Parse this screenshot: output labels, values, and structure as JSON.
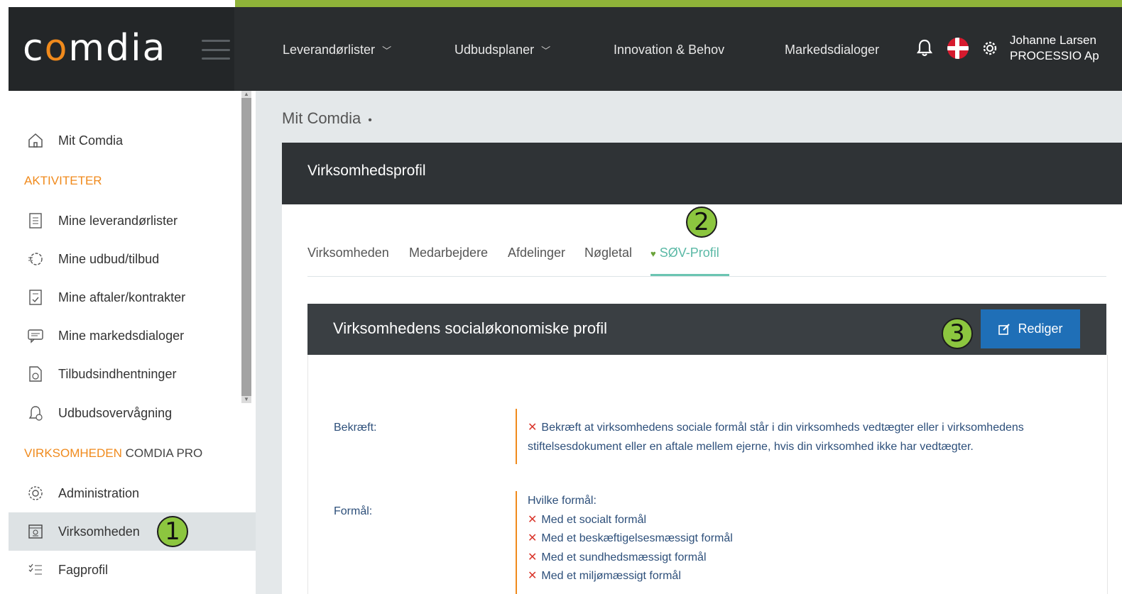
{
  "app": {
    "logo_prefix": "c",
    "logo_o": "o",
    "logo_suffix": "mdia"
  },
  "topnav": {
    "items": [
      {
        "label": "Leverandørlister",
        "has_dropdown": true
      },
      {
        "label": "Udbudsplaner",
        "has_dropdown": true
      },
      {
        "label": "Innovation & Behov",
        "has_dropdown": false
      },
      {
        "label": "Markedsdialoger",
        "has_dropdown": false
      }
    ],
    "user_name": "Johanne Larsen",
    "user_company": "PROCESSIO Ap"
  },
  "sidebar": {
    "home": "Mit Comdia",
    "section_activities": "AKTIVITETER",
    "activities": [
      {
        "label": "Mine leverandørlister",
        "icon": "list-document-icon"
      },
      {
        "label": "Mine udbud/tilbud",
        "icon": "handshake-icon"
      },
      {
        "label": "Mine aftaler/kontrakter",
        "icon": "contract-icon"
      },
      {
        "label": "Mine markedsdialoger",
        "icon": "chat-icon"
      },
      {
        "label": "Tilbudsindhentninger",
        "icon": "document-clock-icon"
      },
      {
        "label": "Udbudsovervågning",
        "icon": "bell-clock-icon"
      }
    ],
    "section_company": "VIRKSOMHEDEN",
    "section_company_suffix": "COMDIA PRO",
    "company_items": [
      {
        "label": "Administration",
        "icon": "gear-icon"
      },
      {
        "label": "Virksomheden",
        "icon": "company-card-icon",
        "active": true
      },
      {
        "label": "Fagprofil",
        "icon": "checklist-icon"
      }
    ]
  },
  "breadcrumb": {
    "current": "Mit Comdia",
    "separator": "•"
  },
  "panel": {
    "title": "Virksomhedsprofil"
  },
  "tabs": [
    {
      "label": "Virksomheden"
    },
    {
      "label": "Medarbejdere"
    },
    {
      "label": "Afdelinger"
    },
    {
      "label": "Nøgletal"
    },
    {
      "label": "SØV-Profil",
      "active": true
    }
  ],
  "card": {
    "title": "Virksomhedens socialøkonomiske profil",
    "edit_label": "Rediger",
    "fields": {
      "bekraeft_label": "Bekræft:",
      "bekraeft_text_1": "Bekræft at virksomhedens sociale formål står i din virksomheds vedtægter eller i virksomhedens",
      "bekraeft_text_2": "stiftelsesdokument eller en aftale mellem ejerne, hvis din virksomhed ikke har vedtægter.",
      "formaal_label": "Formål:",
      "formaal_heading": "Hvilke formål:",
      "formaal_items": [
        "Med et socialt formål",
        "Med et beskæftigelsesmæssigt formål",
        "Med et sundhedsmæssigt formål",
        "Med et miljømæssigt formål"
      ]
    }
  },
  "annotations": {
    "badge1": "1",
    "badge2": "2",
    "badge3": "3"
  },
  "colors": {
    "accent_orange": "#f08a1c",
    "accent_green": "#8cc63f",
    "primary_blue": "#1f6fb7",
    "tab_active": "#5bb9a6",
    "error_red": "#d9352b"
  }
}
